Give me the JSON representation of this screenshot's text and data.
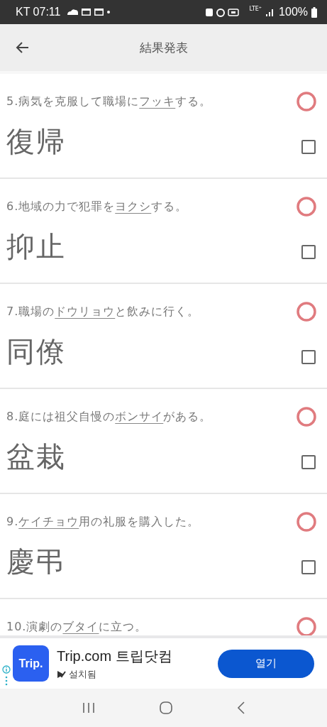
{
  "status_bar": {
    "carrier_time": "KT 07:11",
    "lte": "LTE⁺",
    "battery": "100%"
  },
  "header": {
    "title": "結果発表"
  },
  "questions": [
    {
      "number": "5.",
      "before": "病気を克服して職場に",
      "underlined": "フッキ",
      "after": "する。",
      "answer": "復帰",
      "correct": true,
      "checked": false
    },
    {
      "number": "6.",
      "before": "地域の力で犯罪を",
      "underlined": "ヨクシ",
      "after": "する。",
      "answer": "抑止",
      "correct": true,
      "checked": false
    },
    {
      "number": "7.",
      "before": "職場の",
      "underlined": "ドウリョウ",
      "after": "と飲みに行く。",
      "answer": "同僚",
      "correct": true,
      "checked": false
    },
    {
      "number": "8.",
      "before": "庭には祖父自慢の",
      "underlined": "ボンサイ",
      "after": "がある。",
      "answer": "盆栽",
      "correct": true,
      "checked": false
    },
    {
      "number": "9.",
      "underlined": "ケイチョウ",
      "after": "用の礼服を購入した。",
      "answer": "慶弔",
      "correct": true,
      "checked": false
    },
    {
      "number": "10.",
      "before": "演劇の",
      "underlined": "ブタイ",
      "after": "に立つ。",
      "correct": true
    }
  ],
  "ad": {
    "logo_text": "Trip.",
    "title": "Trip.com 트립닷컴",
    "subtitle": "설치됨",
    "button": "열기"
  }
}
